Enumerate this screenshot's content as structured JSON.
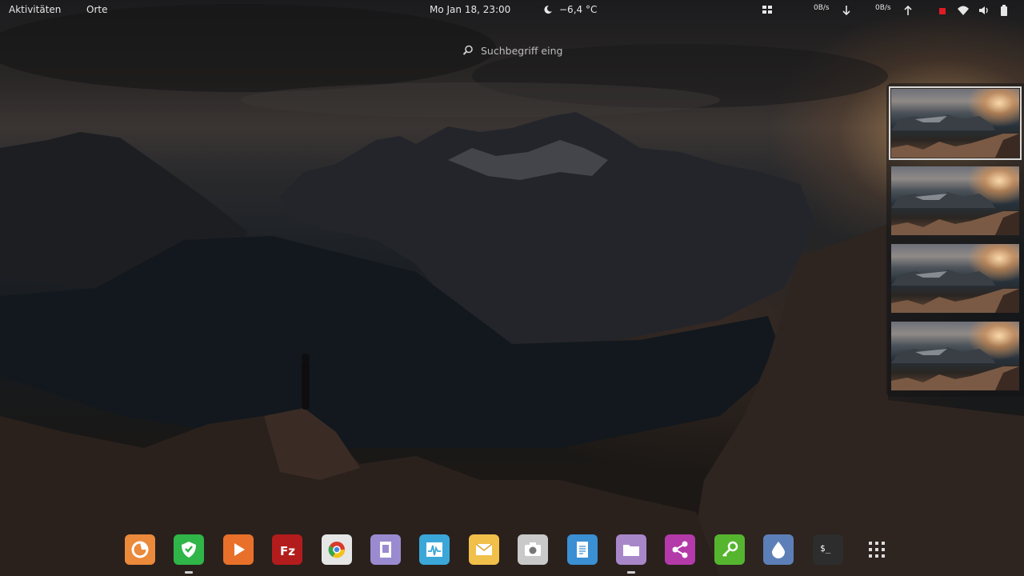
{
  "topbar": {
    "activities": "Aktivitäten",
    "places": "Orte",
    "clock": "Mo Jan 18, 23:00",
    "weather": "−6,4 °C",
    "net_down": "0B/s",
    "net_up": "0B/s"
  },
  "search": {
    "placeholder": "Suchbegriff eing"
  },
  "workspaces": {
    "count": 4,
    "active_index": 0
  },
  "dash": {
    "apps": [
      {
        "name": "firefox-icon",
        "color": "#ea8a3a"
      },
      {
        "name": "shield-browser-icon",
        "color": "#2fb548"
      },
      {
        "name": "media-player-icon",
        "color": "#e8702a"
      },
      {
        "name": "filezilla-icon",
        "color": "#b31c1c"
      },
      {
        "name": "chrome-icon",
        "color": "#e6e6e6"
      },
      {
        "name": "document-viewer-icon",
        "color": "#9a8bd0"
      },
      {
        "name": "system-monitor-icon",
        "color": "#3aa7d8"
      },
      {
        "name": "mail-icon",
        "color": "#f1c04a"
      },
      {
        "name": "screenshot-icon",
        "color": "#c9c9c9"
      },
      {
        "name": "text-document-icon",
        "color": "#3b8fd3"
      },
      {
        "name": "files-icon",
        "color": "#a887c9"
      },
      {
        "name": "share-icon",
        "color": "#b33aa8"
      },
      {
        "name": "keys-icon",
        "color": "#55b52f"
      },
      {
        "name": "water-drop-icon",
        "color": "#5d7fb8"
      },
      {
        "name": "terminal-icon",
        "color": "#2d2d2d"
      },
      {
        "name": "app-grid-icon",
        "color": "#dddddd"
      }
    ]
  }
}
